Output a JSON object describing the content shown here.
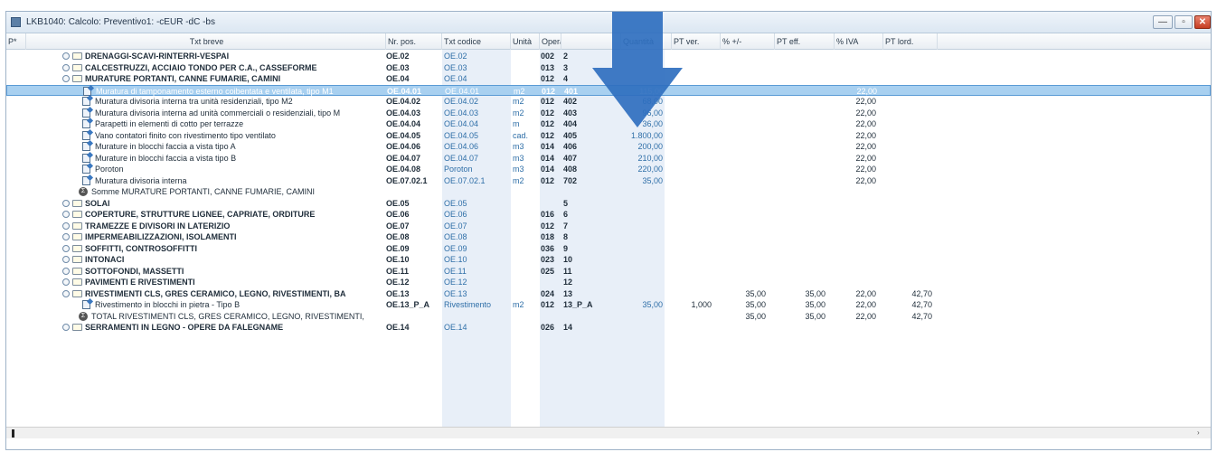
{
  "window": {
    "title": "LKB1040: Calcolo: Preventivo1: -cEUR -dC -bs",
    "buttons": {
      "minimize": "—",
      "maximize": "▫",
      "close": "✕"
    }
  },
  "columns": [
    "P*",
    "Txt breve",
    "Nr. pos.",
    "Txt codice",
    "Unità",
    "Opera",
    "",
    "Quantità",
    "PT ver.",
    "% +/-",
    "PT eff.",
    "% IVA",
    "PT lord."
  ],
  "rows": [
    {
      "type": "group",
      "text": "DRENAGGI-SCAVI-RINTERRI-VESPAI",
      "nrpos": "OE.02",
      "codice": "OE.02",
      "unita": "",
      "opera": "002",
      "n7": "2",
      "val": "",
      "qta": "",
      "ptver": "",
      "pteff": "",
      "iva": "",
      "ptlord": ""
    },
    {
      "type": "group",
      "text": "CALCESTRUZZI, ACCIAIO TONDO PER C.A., CASSEFORME",
      "nrpos": "OE.03",
      "codice": "OE.03",
      "unita": "",
      "opera": "013",
      "n7": "3",
      "val": "",
      "qta": "",
      "ptver": "",
      "pteff": "",
      "iva": "",
      "ptlord": ""
    },
    {
      "type": "group",
      "text": "MURATURE PORTANTI, CANNE FUMARIE, CAMINI",
      "nrpos": "OE.04",
      "codice": "OE.04",
      "unita": "",
      "opera": "012",
      "n7": "4",
      "val": "",
      "qta": "",
      "ptver": "",
      "pteff": "",
      "iva": "",
      "ptlord": ""
    },
    {
      "type": "item",
      "selected": true,
      "text": "Muratura di tamponamento esterno coibentata e ventilata, tipo M1",
      "nrpos": "OE.04.01",
      "codice": "OE.04.01",
      "unita": "m2",
      "opera": "012",
      "n7": "401",
      "val": "115,00",
      "qta": "",
      "ptver": "",
      "pteff": "",
      "iva": "22,00",
      "ptlord": ""
    },
    {
      "type": "item",
      "text": "Muratura divisoria interna tra unità residenziali, tipo M2",
      "nrpos": "OE.04.02",
      "codice": "OE.04.02",
      "unita": "m2",
      "opera": "012",
      "n7": "402",
      "val": "68,00",
      "qta": "",
      "ptver": "",
      "pteff": "",
      "iva": "22,00",
      "ptlord": ""
    },
    {
      "type": "item",
      "text": "Muratura divisoria interna ad unità commerciali o residenziali, tipo M",
      "nrpos": "OE.04.03",
      "codice": "OE.04.03",
      "unita": "m2",
      "opera": "012",
      "n7": "403",
      "val": "96,00",
      "qta": "",
      "ptver": "",
      "pteff": "",
      "iva": "22,00",
      "ptlord": ""
    },
    {
      "type": "item",
      "text": "Parapetti in elementi di cotto per terrazze",
      "nrpos": "OE.04.04",
      "codice": "OE.04.04",
      "unita": "m",
      "opera": "012",
      "n7": "404",
      "val": "36,00",
      "qta": "",
      "ptver": "",
      "pteff": "",
      "iva": "22,00",
      "ptlord": ""
    },
    {
      "type": "item",
      "text": "Vano contatori finito con rivestimento tipo ventilato",
      "nrpos": "OE.04.05",
      "codice": "OE.04.05",
      "unita": "cad.",
      "opera": "012",
      "n7": "405",
      "val": "1.800,00",
      "qta": "",
      "ptver": "",
      "pteff": "",
      "iva": "22,00",
      "ptlord": ""
    },
    {
      "type": "item",
      "text": "Murature in blocchi faccia a vista tipo A",
      "nrpos": "OE.04.06",
      "codice": "OE.04.06",
      "unita": "m3",
      "opera": "014",
      "n7": "406",
      "val": "200,00",
      "qta": "",
      "ptver": "",
      "pteff": "",
      "iva": "22,00",
      "ptlord": ""
    },
    {
      "type": "item",
      "text": "Murature in blocchi faccia a vista tipo B",
      "nrpos": "OE.04.07",
      "codice": "OE.04.07",
      "unita": "m3",
      "opera": "014",
      "n7": "407",
      "val": "210,00",
      "qta": "",
      "ptver": "",
      "pteff": "",
      "iva": "22,00",
      "ptlord": ""
    },
    {
      "type": "item",
      "text": "Poroton",
      "nrpos": "OE.04.08",
      "codice": "Poroton",
      "unita": "m3",
      "opera": "014",
      "n7": "408",
      "val": "220,00",
      "qta": "",
      "ptver": "",
      "pteff": "",
      "iva": "22,00",
      "ptlord": ""
    },
    {
      "type": "item",
      "text": "Muratura divisoria interna",
      "nrpos": "OE.07.02.1",
      "codice": "OE.07.02.1",
      "unita": "m2",
      "opera": "012",
      "n7": "702",
      "val": "35,00",
      "qta": "",
      "ptver": "",
      "pteff": "",
      "iva": "22,00",
      "ptlord": ""
    },
    {
      "type": "sum",
      "text": "Somme MURATURE PORTANTI, CANNE FUMARIE, CAMINI",
      "nrpos": "",
      "codice": "",
      "unita": "",
      "opera": "",
      "n7": "",
      "val": "",
      "qta": "",
      "ptver": "",
      "pteff": "",
      "iva": "",
      "ptlord": ""
    },
    {
      "type": "group",
      "text": "SOLAI",
      "nrpos": "OE.05",
      "codice": "OE.05",
      "unita": "",
      "opera": "",
      "n7": "5",
      "val": "",
      "qta": "",
      "ptver": "",
      "pteff": "",
      "iva": "",
      "ptlord": ""
    },
    {
      "type": "group",
      "text": "COPERTURE, STRUTTURE LIGNEE, CAPRIATE, ORDITURE",
      "nrpos": "OE.06",
      "codice": "OE.06",
      "unita": "",
      "opera": "016",
      "n7": "6",
      "val": "",
      "qta": "",
      "ptver": "",
      "pteff": "",
      "iva": "",
      "ptlord": ""
    },
    {
      "type": "group",
      "text": "TRAMEZZE E DIVISORI IN LATERIZIO",
      "nrpos": "OE.07",
      "codice": "OE.07",
      "unita": "",
      "opera": "012",
      "n7": "7",
      "val": "",
      "qta": "",
      "ptver": "",
      "pteff": "",
      "iva": "",
      "ptlord": ""
    },
    {
      "type": "group",
      "text": "IMPERMEABILIZZAZIONI, ISOLAMENTI",
      "nrpos": "OE.08",
      "codice": "OE.08",
      "unita": "",
      "opera": "018",
      "n7": "8",
      "val": "",
      "qta": "",
      "ptver": "",
      "pteff": "",
      "iva": "",
      "ptlord": ""
    },
    {
      "type": "group",
      "text": "SOFFITTI, CONTROSOFFITTI",
      "nrpos": "OE.09",
      "codice": "OE.09",
      "unita": "",
      "opera": "036",
      "n7": "9",
      "val": "",
      "qta": "",
      "ptver": "",
      "pteff": "",
      "iva": "",
      "ptlord": ""
    },
    {
      "type": "group",
      "text": "INTONACI",
      "nrpos": "OE.10",
      "codice": "OE.10",
      "unita": "",
      "opera": "023",
      "n7": "10",
      "val": "",
      "qta": "",
      "ptver": "",
      "pteff": "",
      "iva": "",
      "ptlord": ""
    },
    {
      "type": "group",
      "text": "SOTTOFONDI, MASSETTI",
      "nrpos": "OE.11",
      "codice": "OE.11",
      "unita": "",
      "opera": "025",
      "n7": "11",
      "val": "",
      "qta": "",
      "ptver": "",
      "pteff": "",
      "iva": "",
      "ptlord": ""
    },
    {
      "type": "group",
      "text": "PAVIMENTI E RIVESTIMENTI",
      "nrpos": "OE.12",
      "codice": "OE.12",
      "unita": "",
      "opera": "",
      "n7": "12",
      "val": "",
      "qta": "",
      "ptver": "",
      "pteff": "",
      "iva": "",
      "ptlord": ""
    },
    {
      "type": "group",
      "text": "RIVESTIMENTI CLS, GRES CERAMICO, LEGNO, RIVESTIMENTI, BA",
      "nrpos": "OE.13",
      "codice": "OE.13",
      "unita": "",
      "opera": "024",
      "n7": "13",
      "val": "",
      "qta": "",
      "ptver": "35,00",
      "pteff": "35,00",
      "iva": "22,00",
      "ptlord": "42,70"
    },
    {
      "type": "item",
      "text": "Rivestimento in blocchi in pietra - Tipo B",
      "nrpos": "OE.13_P_A",
      "codice": "Rivestimento",
      "unita": "m2",
      "opera": "012",
      "n7": "13_P_A",
      "val": "35,00",
      "qta": "1,000",
      "ptver": "35,00",
      "pteff": "35,00",
      "iva": "22,00",
      "ptlord": "42,70"
    },
    {
      "type": "sum",
      "text": "TOTAL RIVESTIMENTI CLS, GRES CERAMICO, LEGNO, RIVESTIMENTI,",
      "nrpos": "",
      "codice": "",
      "unita": "",
      "opera": "",
      "n7": "",
      "val": "",
      "qta": "",
      "ptver": "35,00",
      "pteff": "35,00",
      "iva": "22,00",
      "ptlord": "42,70"
    },
    {
      "type": "group",
      "text": "SERRAMENTI IN LEGNO - OPERE DA FALEGNAME",
      "nrpos": "OE.14",
      "codice": "OE.14",
      "unita": "",
      "opera": "026",
      "n7": "14",
      "val": "",
      "qta": "",
      "ptver": "",
      "pteff": "",
      "iva": "",
      "ptlord": ""
    }
  ],
  "icons": {
    "window": "app-icon",
    "group": "folder-icon",
    "item": "document-icon",
    "sum": "sum-icon",
    "overlay": "arrow-down-icon"
  },
  "colors": {
    "accent": "#3a78c0",
    "selection": "#a8d0f0",
    "arrow": "#2f6fbf"
  }
}
